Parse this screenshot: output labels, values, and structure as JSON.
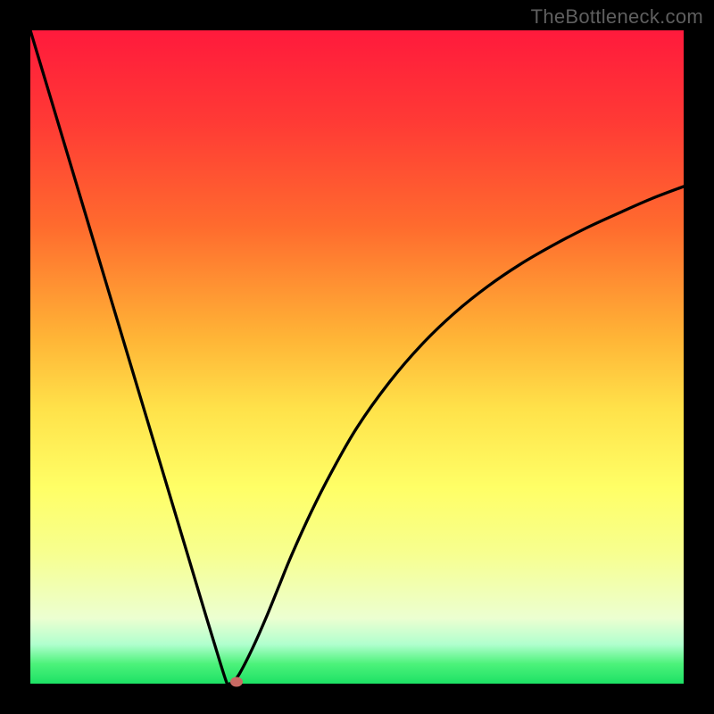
{
  "watermark": "TheBottleneck.com",
  "colors": {
    "curve_stroke": "#000000",
    "marker_fill": "#c96a64",
    "frame_bg": "#000000"
  },
  "chart_data": {
    "type": "line",
    "title": "",
    "xlabel": "",
    "ylabel": "",
    "xlim": [
      0,
      1
    ],
    "ylim": [
      0,
      1
    ],
    "grid": false,
    "series": [
      {
        "name": "bottleneck-curve",
        "x": [
          0.0,
          0.03,
          0.06,
          0.09,
          0.12,
          0.15,
          0.18,
          0.21,
          0.24,
          0.26,
          0.28,
          0.3,
          0.305,
          0.31,
          0.32,
          0.34,
          0.36,
          0.38,
          0.4,
          0.43,
          0.46,
          0.5,
          0.55,
          0.6,
          0.65,
          0.7,
          0.75,
          0.8,
          0.85,
          0.9,
          0.95,
          1.0
        ],
        "y": [
          1.0,
          0.9,
          0.8,
          0.7,
          0.6,
          0.5,
          0.4,
          0.3,
          0.2,
          0.133,
          0.067,
          0.003,
          0.0,
          0.003,
          0.015,
          0.054,
          0.099,
          0.148,
          0.197,
          0.263,
          0.322,
          0.392,
          0.462,
          0.52,
          0.568,
          0.608,
          0.642,
          0.671,
          0.697,
          0.72,
          0.742,
          0.761
        ]
      }
    ],
    "marker": {
      "x": 0.316,
      "y": 0.003
    }
  }
}
